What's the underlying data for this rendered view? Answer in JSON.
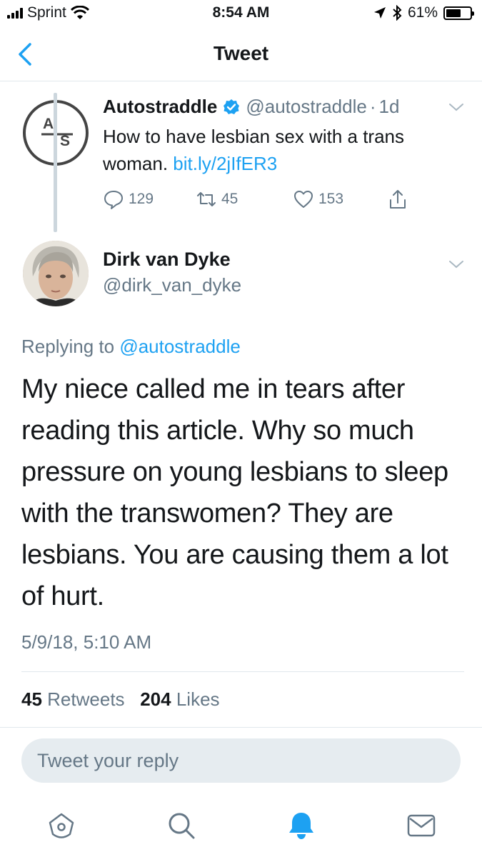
{
  "status_bar": {
    "carrier": "Sprint",
    "time": "8:54 AM",
    "battery_percent": "61%",
    "battery_level": 0.61
  },
  "nav": {
    "title": "Tweet",
    "back_icon": "chevron-left-icon"
  },
  "quoted_tweet": {
    "name": "Autostraddle",
    "handle": "@autostraddle",
    "dot": "·",
    "time": "1d",
    "text": "How to have lesbian sex with a trans woman.",
    "link": "bit.ly/2jIfER3",
    "avatar_letters": [
      "A",
      "S"
    ],
    "replies": "129",
    "retweets": "45",
    "likes": "153"
  },
  "reply": {
    "author_name": "Dirk van Dyke",
    "author_handle": "@dirk_van_dyke",
    "replying_prefix": "Replying to",
    "replying_to": "@autostraddle",
    "text": "My niece called me in tears after reading this article. Why so much pressure on young lesbians to sleep with the transwomen? They are lesbians. You are causing them a lot of hurt.",
    "date": "5/9/18, 5:10 AM",
    "retweet_count": "45",
    "retweet_label": "Retweets",
    "like_count": "204",
    "like_label": "Likes"
  },
  "composer": {
    "placeholder": "Tweet your reply"
  },
  "tabbar": {
    "items": [
      "home-icon",
      "search-icon",
      "notifications-icon",
      "messages-icon"
    ],
    "active": "notifications-icon"
  },
  "colors": {
    "accent": "#1da1f2",
    "secondary_text": "#657786",
    "divider": "#e1e8ed"
  }
}
